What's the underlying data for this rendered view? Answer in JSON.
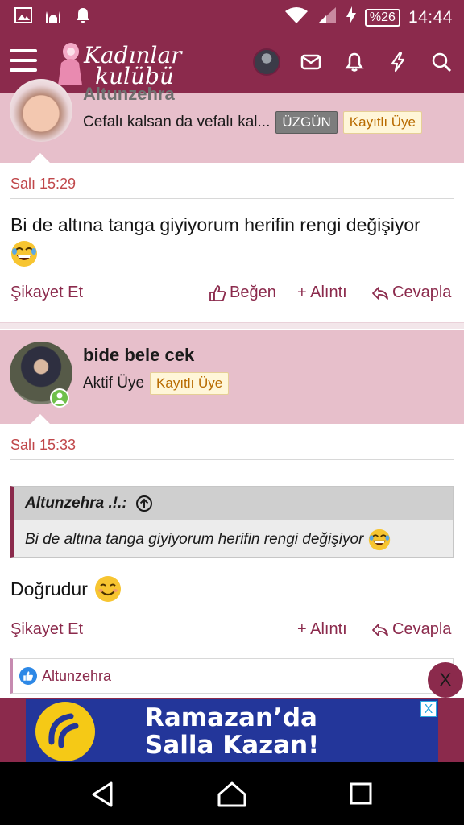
{
  "status_bar": {
    "battery": "%26",
    "time": "14:44"
  },
  "header": {
    "logo_line1": "Kadınlar",
    "logo_line2": "kulübü",
    "menu_icon": "hamburger-icon",
    "icons": [
      "avatar",
      "mail-icon",
      "bell-icon",
      "lightning-icon",
      "search-icon"
    ]
  },
  "post1": {
    "username": "Altunzehra",
    "user_status": "Cefalı kalsan da vefalı kal...",
    "mood_badge": "ÜZGÜN",
    "role_badge": "Kayıtlı Üye",
    "date": "Salı 15:29",
    "body": "Bi de altına tanga giyiyorum herifin rengi değişiyor",
    "actions": {
      "report": "Şikayet Et",
      "like": "Beğen",
      "quote": "+ Alıntı",
      "reply": "Cevapla"
    }
  },
  "post2": {
    "username": "bide bele cek",
    "user_status": "Aktif Üye",
    "role_badge": "Kayıtlı Üye",
    "date": "Salı 15:33",
    "quote": {
      "author": "Altunzehra .!.:",
      "text": "Bi de altına tanga giyiyorum herifin rengi değişiyor"
    },
    "body": "Doğrudur",
    "actions": {
      "report": "Şikayet Et",
      "quote": "+ Alıntı",
      "reply": "Cevapla"
    },
    "liked_by": "Altunzehra"
  },
  "ad": {
    "line1": "Ramazan’da",
    "line2": "Salla Kazan!",
    "close_label": "X"
  },
  "overlay_close": "X",
  "colors": {
    "brand": "#8b2a4c",
    "header_bg": "#e7bfcb",
    "date_red": "#c0474a",
    "ad_blue": "#23369a",
    "ad_yellow": "#f5c916"
  }
}
